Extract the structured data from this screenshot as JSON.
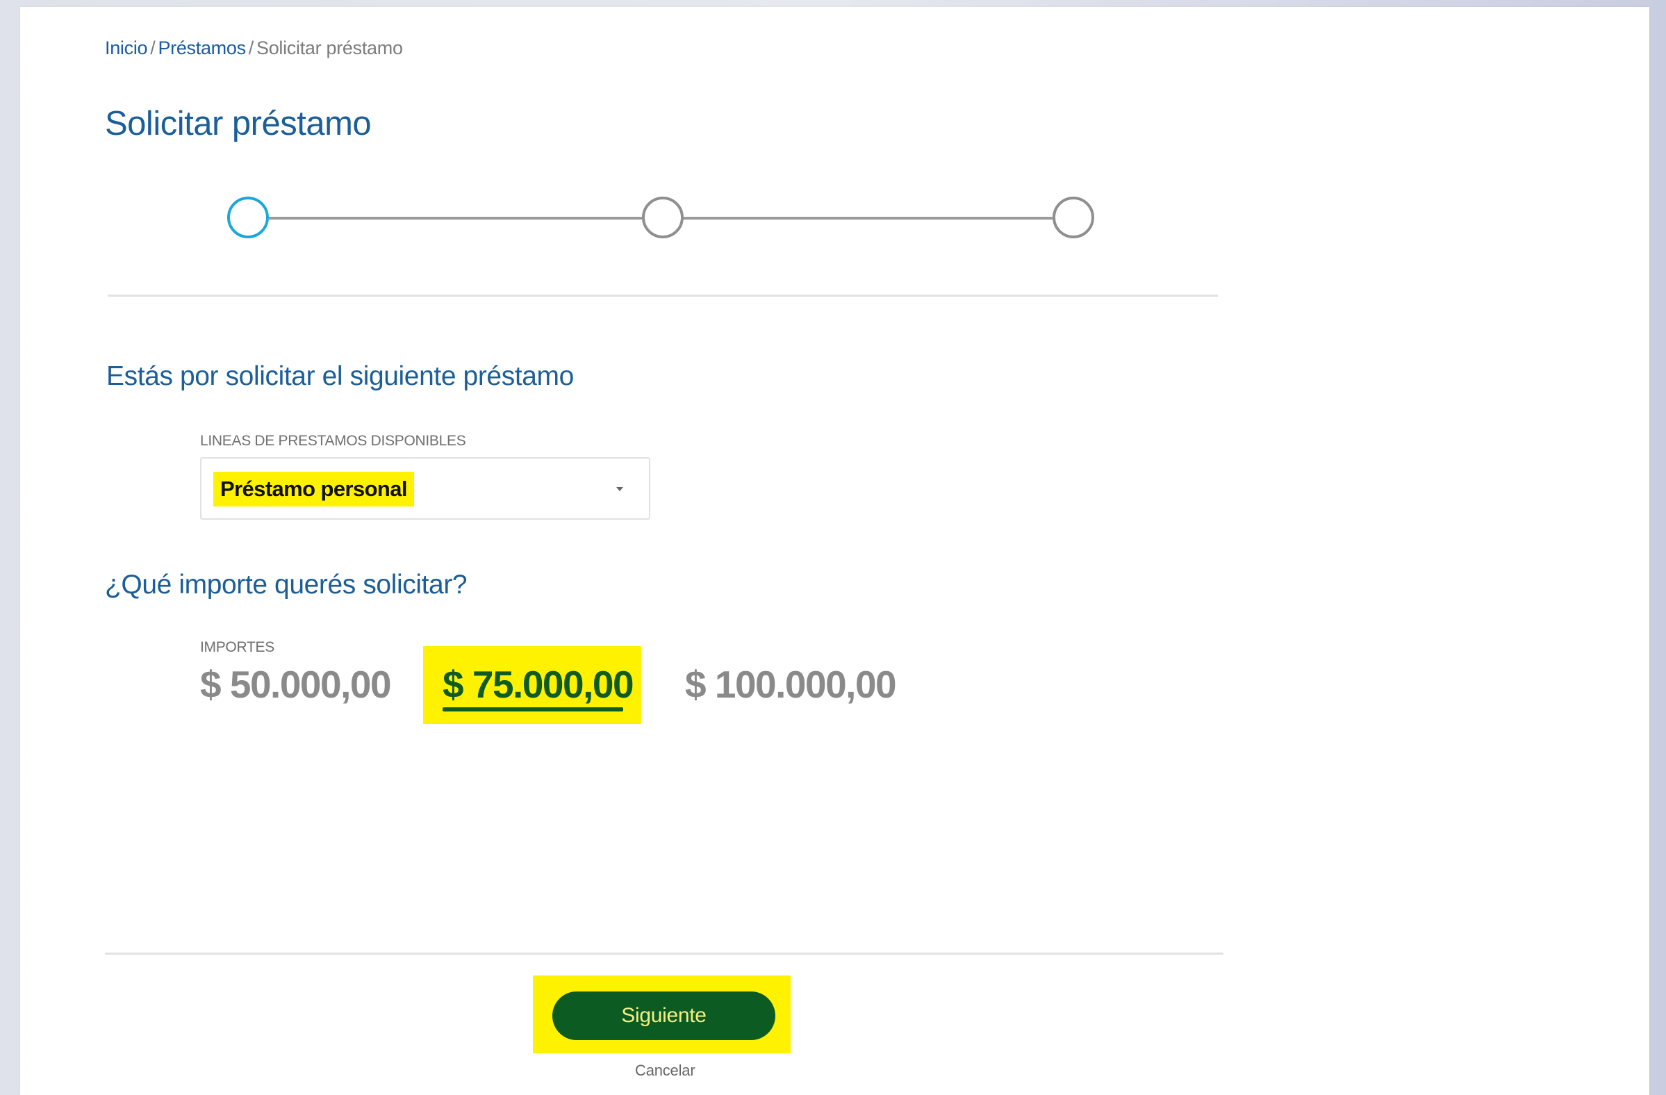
{
  "breadcrumb": {
    "home": "Inicio",
    "loans": "Préstamos",
    "current": "Solicitar préstamo",
    "separator": "/"
  },
  "page": {
    "title": "Solicitar préstamo"
  },
  "stepper": {
    "total_steps": 3,
    "active_step": 1
  },
  "loan_section": {
    "heading": "Estás por solicitar el siguiente préstamo",
    "field_label": "LINEAS  DE PRESTAMOS DISPONIBLES",
    "selected_value": "Préstamo personal"
  },
  "amount_section": {
    "heading": "¿Qué importe querés solicitar?",
    "field_label": "IMPORTES",
    "options": [
      "$ 50.000,00",
      "$ 75.000,00",
      "$ 100.000,00"
    ],
    "selected_index": 1
  },
  "actions": {
    "next_label": "Siguiente",
    "cancel_label": "Cancelar"
  },
  "colors": {
    "brand_blue": "#1b5e98",
    "link_blue": "#1a5aa6",
    "active_step": "#1ca7d8",
    "highlight_yellow": "#fff200",
    "button_green": "#0c5b23",
    "button_text": "#f1ef86"
  }
}
